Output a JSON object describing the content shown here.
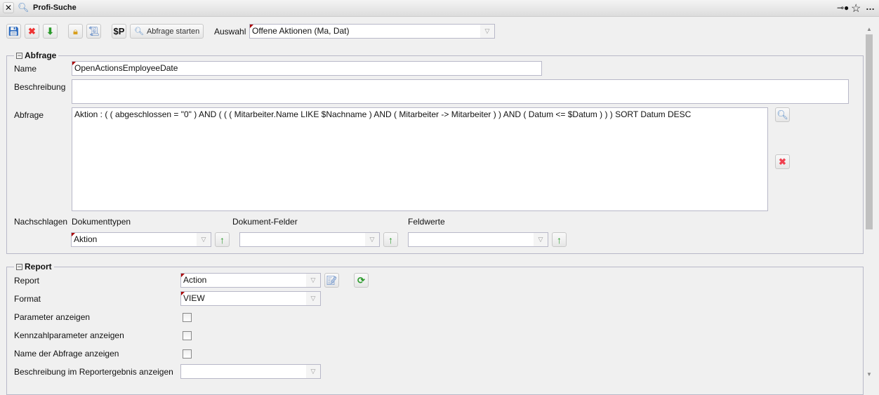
{
  "window": {
    "title": "Profi-Suche"
  },
  "toolbar": {
    "dollar_p": "$P",
    "run_query": "Abfrage starten",
    "selection_label": "Auswahl",
    "selection_value": "Offene Aktionen (Ma, Dat)"
  },
  "query": {
    "legend": "Abfrage",
    "name_label": "Name",
    "name_value": "OpenActionsEmployeeDate",
    "description_label": "Beschreibung",
    "description_value": "",
    "query_label": "Abfrage",
    "query_value": "Aktion : ( ( abgeschlossen = \"0\" ) AND ( ( ( Mitarbeiter.Name LIKE $Nachname ) AND ( Mitarbeiter -> Mitarbeiter ) ) AND ( Datum <= $Datum ) ) ) SORT Datum DESC",
    "lookup_label": "Nachschlagen",
    "doc_types_label": "Dokumenttypen",
    "doc_types_value": "Aktion",
    "doc_fields_label": "Dokument-Felder",
    "doc_fields_value": "",
    "field_values_label": "Feldwerte",
    "field_values_value": ""
  },
  "report": {
    "legend": "Report",
    "report_label": "Report",
    "report_value": "Action",
    "format_label": "Format",
    "format_value": "VIEW",
    "show_params_label": "Parameter anzeigen",
    "show_params": false,
    "show_kpi_params_label": "Kennzahlparameter anzeigen",
    "show_kpi_params": false,
    "show_query_name_label": "Name der Abfrage anzeigen",
    "show_query_name": false,
    "show_description_label": "Beschreibung im Reportergebnis anzeigen",
    "show_description_value": ""
  }
}
